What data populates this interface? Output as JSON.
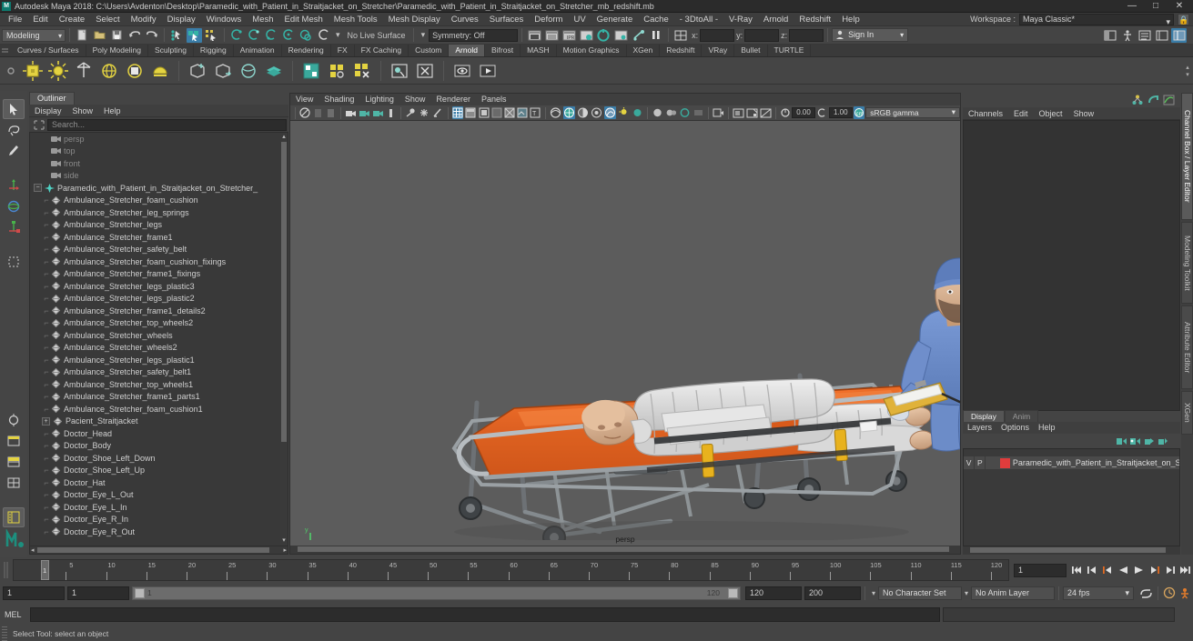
{
  "window": {
    "title": "Autodesk Maya 2018: C:\\Users\\Avdenton\\Desktop\\Paramedic_with_Patient_in_Straitjacket_on_Stretcher\\Paramedic_with_Patient_in_Straitjacket_on_Stretcher_mb_redshift.mb",
    "logo": "M",
    "minimize": "—",
    "maximize": "□",
    "close": "✕"
  },
  "menubar": {
    "items": [
      "File",
      "Edit",
      "Create",
      "Select",
      "Modify",
      "Display",
      "Windows",
      "Mesh",
      "Edit Mesh",
      "Mesh Tools",
      "Mesh Display",
      "Curves",
      "Surfaces",
      "Deform",
      "UV",
      "Generate",
      "Cache",
      "- 3DtoAll -",
      "V-Ray",
      "Arnold",
      "Redshift",
      "Help"
    ],
    "workspace_label": "Workspace :",
    "workspace_value": "Maya Classic*"
  },
  "statusline": {
    "mode": "Modeling",
    "live_surface": "No Live Surface",
    "symmetry": "Symmetry: Off",
    "x_label": "x:",
    "y_label": "y:",
    "z_label": "z:",
    "x_value": "",
    "y_value": "",
    "z_value": "",
    "signin": "Sign In"
  },
  "shelf": {
    "tabs": [
      "Curves / Surfaces",
      "Poly Modeling",
      "Sculpting",
      "Rigging",
      "Animation",
      "Rendering",
      "FX",
      "FX Caching",
      "Custom",
      "Arnold",
      "Bifrost",
      "MASH",
      "Motion Graphics",
      "XGen",
      "Redshift",
      "VRay",
      "Bullet",
      "TURTLE"
    ],
    "active_tab": "Arnold"
  },
  "outliner": {
    "tab": "Outliner",
    "menu": [
      "Display",
      "Show",
      "Help"
    ],
    "search_placeholder": "Search...",
    "items": [
      {
        "label": "persp",
        "type": "camera",
        "dim": true,
        "indent": 1
      },
      {
        "label": "top",
        "type": "camera",
        "dim": true,
        "indent": 1
      },
      {
        "label": "front",
        "type": "camera",
        "dim": true,
        "indent": 1
      },
      {
        "label": "side",
        "type": "camera",
        "dim": true,
        "indent": 1
      },
      {
        "label": "Paramedic_with_Patient_in_Straitjacket_on_Stretcher_",
        "type": "group",
        "dim": false,
        "indent": 0,
        "expanded": true
      },
      {
        "label": "Ambulance_Stretcher_foam_cushion",
        "type": "mesh",
        "dim": false,
        "indent": 1
      },
      {
        "label": "Ambulance_Stretcher_leg_springs",
        "type": "mesh",
        "dim": false,
        "indent": 1
      },
      {
        "label": "Ambulance_Stretcher_legs",
        "type": "mesh",
        "dim": false,
        "indent": 1
      },
      {
        "label": "Ambulance_Stretcher_frame1",
        "type": "mesh",
        "dim": false,
        "indent": 1
      },
      {
        "label": "Ambulance_Stretcher_safety_belt",
        "type": "mesh",
        "dim": false,
        "indent": 1
      },
      {
        "label": "Ambulance_Stretcher_foam_cushion_fixings",
        "type": "mesh",
        "dim": false,
        "indent": 1
      },
      {
        "label": "Ambulance_Stretcher_frame1_fixings",
        "type": "mesh",
        "dim": false,
        "indent": 1
      },
      {
        "label": "Ambulance_Stretcher_legs_plastic3",
        "type": "mesh",
        "dim": false,
        "indent": 1
      },
      {
        "label": "Ambulance_Stretcher_legs_plastic2",
        "type": "mesh",
        "dim": false,
        "indent": 1
      },
      {
        "label": "Ambulance_Stretcher_frame1_details2",
        "type": "mesh",
        "dim": false,
        "indent": 1
      },
      {
        "label": "Ambulance_Stretcher_top_wheels2",
        "type": "mesh",
        "dim": false,
        "indent": 1
      },
      {
        "label": "Ambulance_Stretcher_wheels",
        "type": "mesh",
        "dim": false,
        "indent": 1
      },
      {
        "label": "Ambulance_Stretcher_wheels2",
        "type": "mesh",
        "dim": false,
        "indent": 1
      },
      {
        "label": "Ambulance_Stretcher_legs_plastic1",
        "type": "mesh",
        "dim": false,
        "indent": 1
      },
      {
        "label": "Ambulance_Stretcher_safety_belt1",
        "type": "mesh",
        "dim": false,
        "indent": 1
      },
      {
        "label": "Ambulance_Stretcher_top_wheels1",
        "type": "mesh",
        "dim": false,
        "indent": 1
      },
      {
        "label": "Ambulance_Stretcher_frame1_parts1",
        "type": "mesh",
        "dim": false,
        "indent": 1
      },
      {
        "label": "Ambulance_Stretcher_foam_cushion1",
        "type": "mesh",
        "dim": false,
        "indent": 1
      },
      {
        "label": "Pacient_Straitjacket",
        "type": "mesh",
        "dim": false,
        "indent": 1,
        "expandable": true
      },
      {
        "label": "Doctor_Head",
        "type": "mesh",
        "dim": false,
        "indent": 1
      },
      {
        "label": "Doctor_Body",
        "type": "mesh",
        "dim": false,
        "indent": 1
      },
      {
        "label": "Doctor_Shoe_Left_Down",
        "type": "mesh",
        "dim": false,
        "indent": 1
      },
      {
        "label": "Doctor_Shoe_Left_Up",
        "type": "mesh",
        "dim": false,
        "indent": 1
      },
      {
        "label": "Doctor_Hat",
        "type": "mesh",
        "dim": false,
        "indent": 1
      },
      {
        "label": "Doctor_Eye_L_Out",
        "type": "mesh",
        "dim": false,
        "indent": 1
      },
      {
        "label": "Doctor_Eye_L_In",
        "type": "mesh",
        "dim": false,
        "indent": 1
      },
      {
        "label": "Doctor_Eye_R_In",
        "type": "mesh",
        "dim": false,
        "indent": 1
      },
      {
        "label": "Doctor_Eye_R_Out",
        "type": "mesh",
        "dim": false,
        "indent": 1
      }
    ]
  },
  "viewport": {
    "menu": [
      "View",
      "Shading",
      "Lighting",
      "Show",
      "Renderer",
      "Panels"
    ],
    "exposure": "0.00",
    "gamma": "1.00",
    "color_management": "sRGB gamma",
    "camera_label": "persp"
  },
  "channelbox": {
    "menu": [
      "Channels",
      "Edit",
      "Object",
      "Show"
    ]
  },
  "layers": {
    "tabs": [
      "Display",
      "Anim"
    ],
    "active_tab": "Display",
    "menu": [
      "Layers",
      "Options",
      "Help"
    ],
    "rows": [
      {
        "v": "V",
        "p": "P",
        "color": "#e03c3c",
        "name": "Paramedic_with_Patient_in_Straitjacket_on_Stretche"
      }
    ]
  },
  "vtabs": [
    "Channel Box / Layer Editor",
    "Modeling Toolkit",
    "Attribute Editor",
    "XGen"
  ],
  "timeline": {
    "start": 1,
    "end": 120,
    "current": "1",
    "tick_labels": [
      5,
      10,
      15,
      20,
      25,
      30,
      35,
      40,
      45,
      50,
      55,
      60,
      65,
      70,
      75,
      80,
      85,
      90,
      95,
      100,
      105,
      110,
      115,
      120
    ],
    "playback_buttons": [
      "go-to-start",
      "step-back-key",
      "step-back-frame",
      "play-backwards",
      "play-forwards",
      "step-forward-frame",
      "step-forward-key",
      "go-to-end"
    ]
  },
  "range": {
    "anim_start": "1",
    "range_start": "1",
    "slider_min": "1",
    "slider_max": "120",
    "range_end": "120",
    "anim_end": "200",
    "character_set": "No Character Set",
    "anim_layer": "No Anim Layer",
    "fps": "24 fps"
  },
  "command": {
    "language": "MEL",
    "input": "",
    "output": ""
  },
  "status": {
    "help_text": "Select Tool: select an object"
  }
}
